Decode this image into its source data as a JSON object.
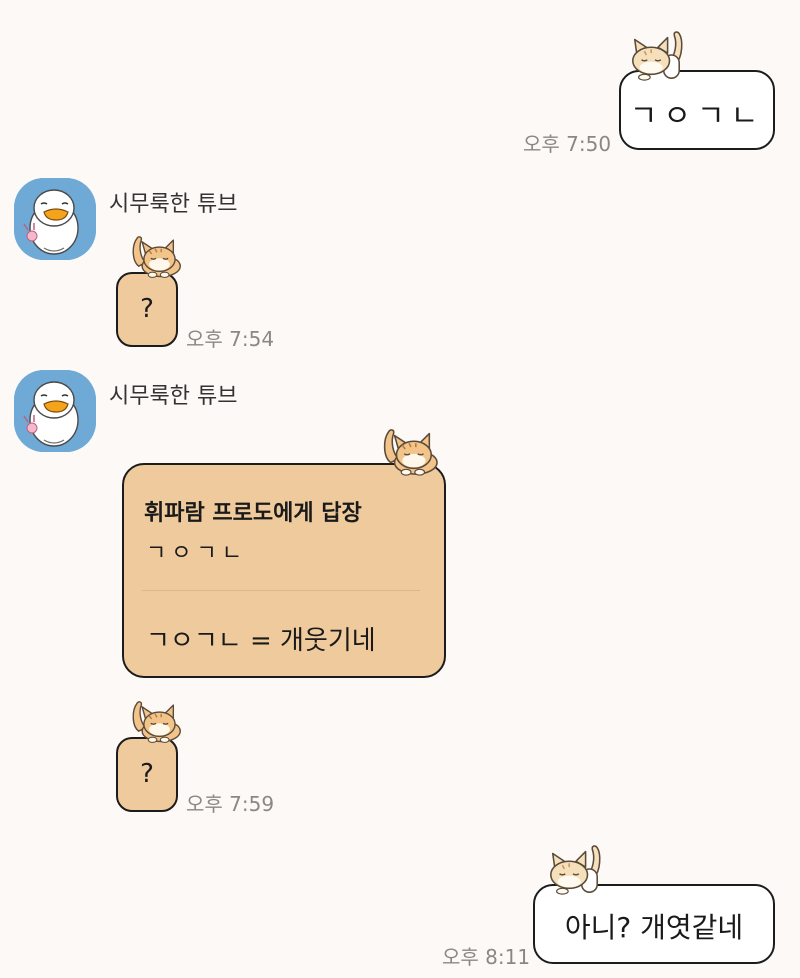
{
  "messages": [
    {
      "type": "out",
      "text": "ㄱㅇㄱㄴ",
      "time": "오후 7:50"
    },
    {
      "type": "in",
      "sender": "시무룩한 튜브",
      "text": "?",
      "time": "오후 7:54"
    },
    {
      "type": "in",
      "sender": "시무룩한 튜브",
      "reply_header": "휘파람 프로도에게 답장",
      "reply_quote": "ㄱㅇㄱㄴ",
      "text": "ㄱㅇㄱㄴ = 개웃기네"
    },
    {
      "type": "in",
      "text": "?",
      "time": "오후 7:59"
    },
    {
      "type": "out",
      "text": "아니? 개엿같네",
      "time": "오후 8:11"
    }
  ],
  "colors": {
    "background": "#fdf9f6",
    "incoming_bubble": "#efca9c",
    "outgoing_bubble": "#ffffff",
    "avatar_bg": "#6fa9d6"
  },
  "icons": {
    "avatar": "tube-duck-avatar-icon",
    "bubble_decoration": "sleeping-cat-icon"
  }
}
